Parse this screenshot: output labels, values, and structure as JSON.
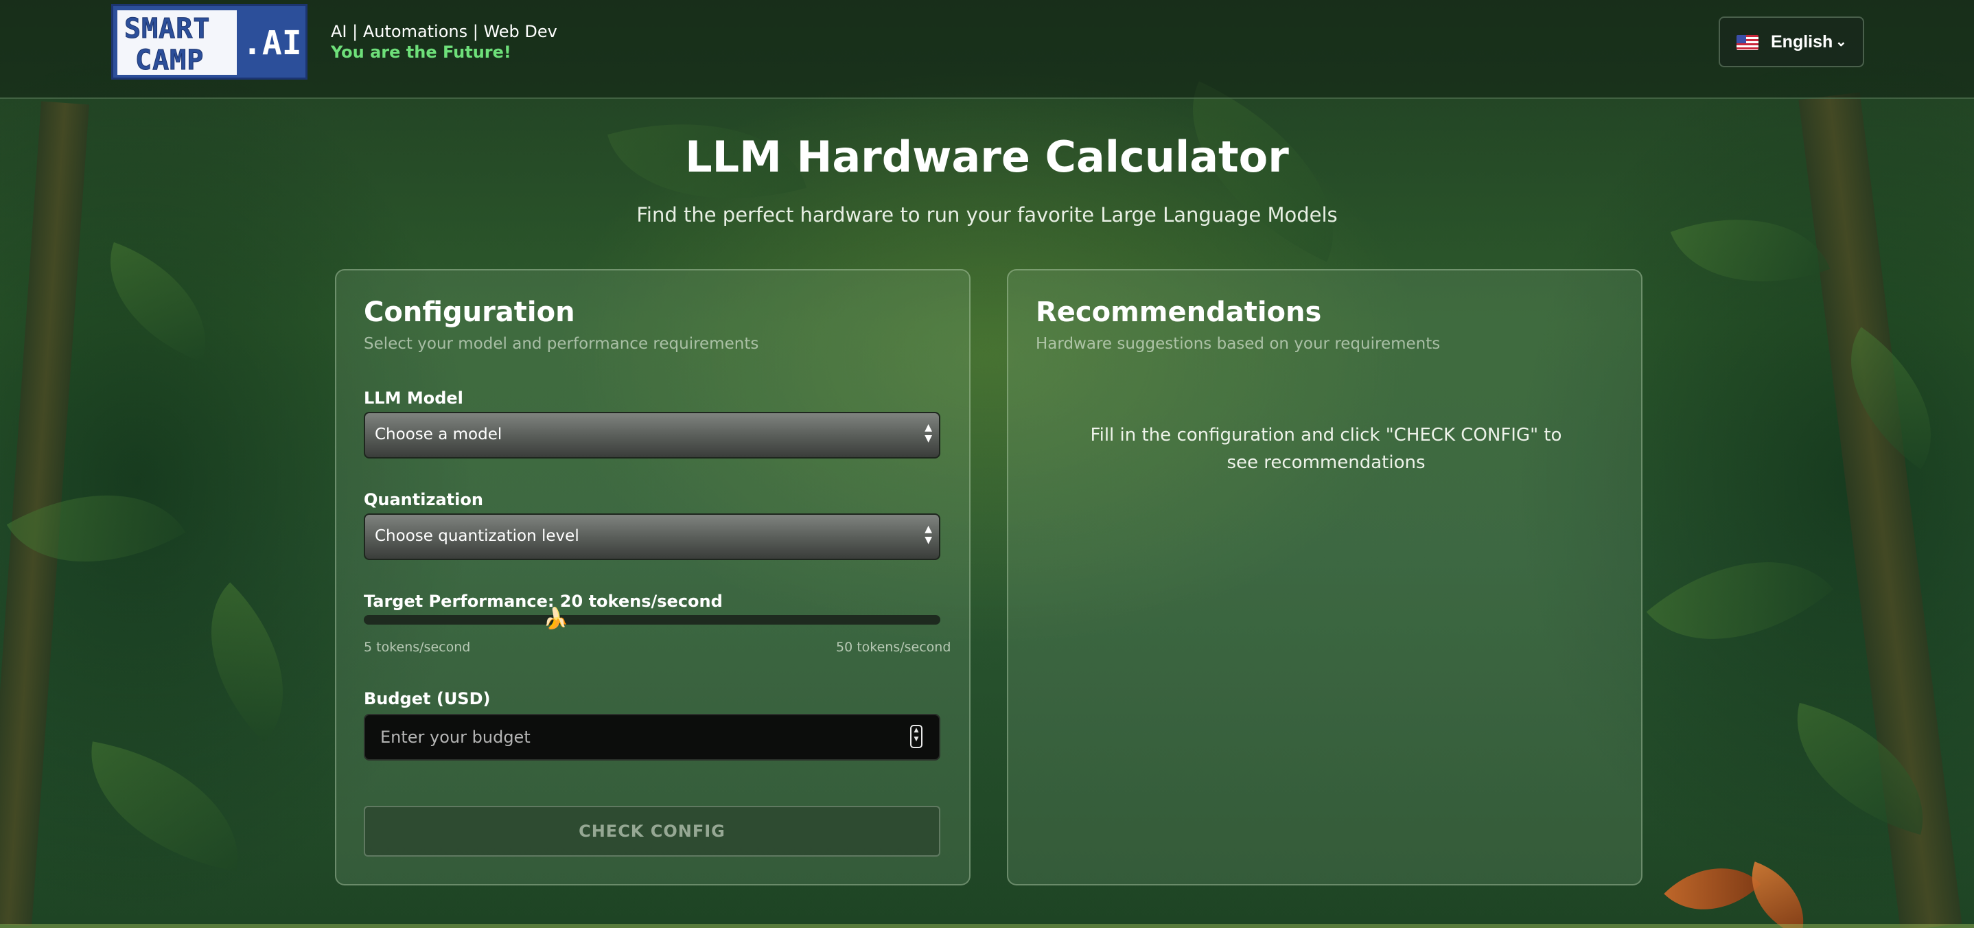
{
  "header": {
    "logo": {
      "line1": "SMART",
      "line2": "CAMP",
      "suffix": ".AI"
    },
    "tagline": "AI | Automations | Web Dev",
    "slogan": "You are the Future!",
    "language": {
      "label": "English",
      "flag": "us-flag-icon"
    }
  },
  "hero": {
    "title": "LLM Hardware Calculator",
    "subtitle": "Find the perfect hardware to run your favorite Large Language Models"
  },
  "config": {
    "title": "Configuration",
    "description": "Select your model and performance requirements",
    "model": {
      "label": "LLM Model",
      "value": "Choose a model"
    },
    "quantization": {
      "label": "Quantization",
      "value": "Choose quantization level"
    },
    "performance": {
      "label": "Target Performance: 20 tokens/second",
      "value": 20,
      "min": 5,
      "max": 50,
      "min_label": "5 tokens/second",
      "max_label": "50 tokens/second"
    },
    "budget": {
      "label": "Budget (USD)",
      "placeholder": "Enter your budget"
    },
    "submit_label": "CHECK CONFIG"
  },
  "recommendations": {
    "title": "Recommendations",
    "description": "Hardware suggestions based on your requirements",
    "empty_message": "Fill in the configuration and click \"CHECK CONFIG\" to see recommendations"
  }
}
